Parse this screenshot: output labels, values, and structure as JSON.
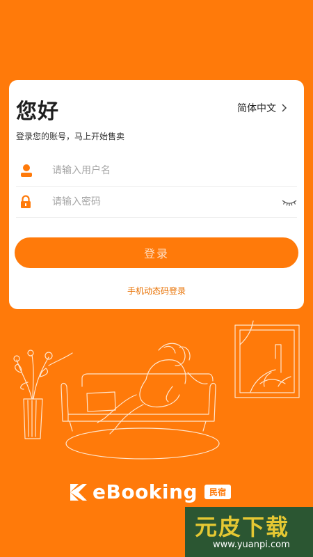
{
  "login": {
    "greeting": "您好",
    "language": "简体中文",
    "subtitle": "登录您的账号，马上开始售卖",
    "username_placeholder": "请输入用户名",
    "password_placeholder": "请输入密码",
    "login_button": "登录",
    "sms_login_link": "手机动态码登录"
  },
  "brand": {
    "name": "eBooking",
    "tag": "民宿"
  },
  "watermark": {
    "title": "元皮下载",
    "url": "www.yuanpi.com"
  },
  "colors": {
    "primary": "#FF7A0A",
    "card": "#FFFFFF",
    "link": "#E87000"
  },
  "icons": [
    "user-icon",
    "lock-icon",
    "eye-closed-icon",
    "chevron-right-icon",
    "ebooking-logo-icon"
  ]
}
